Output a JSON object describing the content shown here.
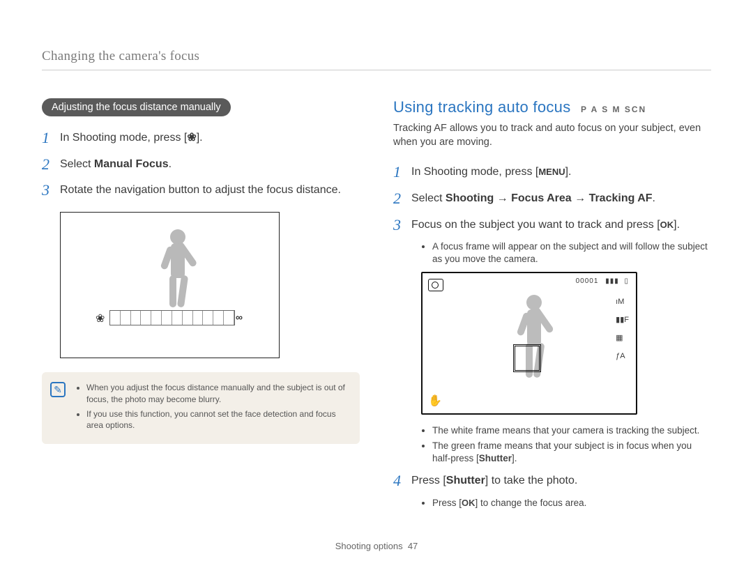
{
  "header": "Changing the camera's focus",
  "left": {
    "pill": "Adjusting the focus distance manually",
    "step1_pre": "In Shooting mode, press [",
    "step1_icon": "flower-icon",
    "step1_post": "].",
    "step2_pre": "Select ",
    "step2_bold": "Manual Focus",
    "step2_post": ".",
    "step3": "Rotate the navigation button to adjust the focus distance.",
    "note1": "When you adjust the focus distance manually and the subject is out of focus, the photo may become blurry.",
    "note2": "If you use this function, you cannot set the face detection and focus area options."
  },
  "right": {
    "title": "Using tracking auto focus",
    "modes": "P A S M SCN",
    "intro": "Tracking AF allows you to track and auto focus on your subject, even when you are moving.",
    "step1_pre": "In Shooting mode, press [",
    "step1_key": "MENU",
    "step1_post": "].",
    "step2_pre": "Select ",
    "step2_b1": "Shooting",
    "step2_arrow": " → ",
    "step2_b2": "Focus Area",
    "step2_b3": "Tracking AF",
    "step2_post": ".",
    "step3_pre": "Focus on  the subject you want to track and press [",
    "step3_key": "OK",
    "step3_post": "].",
    "step3_bullet": "A focus frame will appear on the subject and will follow the subject as you move the camera.",
    "lcd_counter": "00001",
    "lcd_right_items": [
      "ıM",
      "▮▮F",
      "▦",
      "ƒA"
    ],
    "after_b1": "The white frame means that your camera is tracking the subject.",
    "after_b2_pre": "The green frame means that your subject is in focus when you half-press [",
    "after_b2_bold": "Shutter",
    "after_b2_post": "].",
    "step4_pre": "Press [",
    "step4_bold": "Shutter",
    "step4_post": "] to take the photo.",
    "step4_sub_pre": "Press [",
    "step4_sub_key": "OK",
    "step4_sub_post": "] to change the focus area."
  },
  "footer_label": "Shooting options",
  "footer_page": "47"
}
